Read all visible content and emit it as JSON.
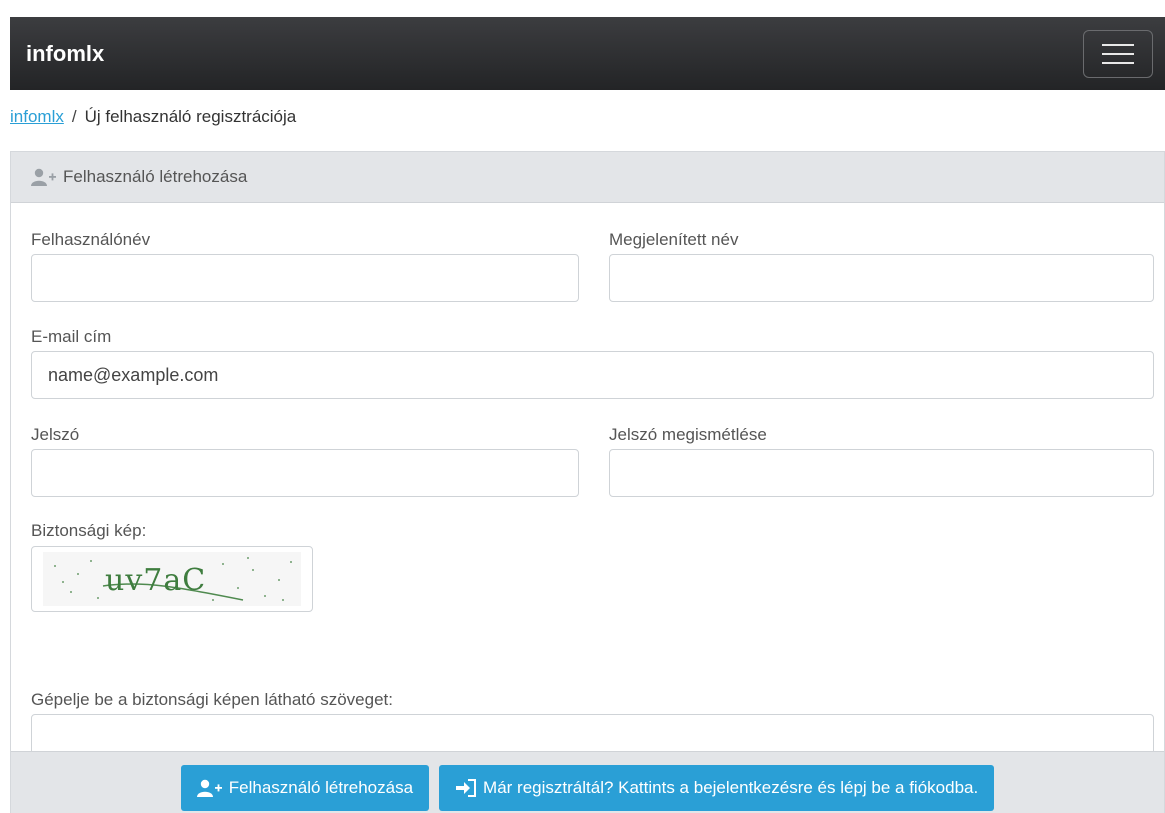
{
  "navbar": {
    "brand": "infomlx"
  },
  "breadcrumb": {
    "home": "infomlx",
    "separator": "/",
    "current": "Új felhasználó regisztrációja"
  },
  "card": {
    "header_title": "Felhasználó létrehozása",
    "fields": {
      "username_label": "Felhasználónév",
      "display_name_label": "Megjelenített név",
      "email_label": "E-mail cím",
      "email_placeholder": "name@example.com",
      "password_label": "Jelszó",
      "password_repeat_label": "Jelszó megismétlése",
      "captcha_label": "Biztonsági kép:",
      "captcha_text": "uv7aC",
      "captcha_input_label": "Gépelje be a biztonsági képen látható szöveget:"
    },
    "footer": {
      "create_button": "Felhasználó létrehozása",
      "login_button": "Már regisztráltál? Kattints a bejelentkezésre és lépj be a fiókodba."
    }
  },
  "colors": {
    "accent": "#2a9fd6",
    "navbar": "#2d2e30",
    "card_header": "#e3e5e8"
  }
}
